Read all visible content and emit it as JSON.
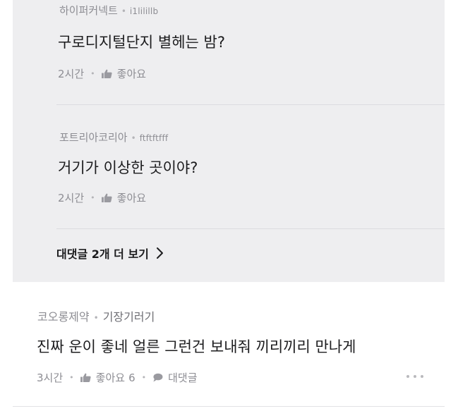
{
  "colors": {
    "reply_background": "#eeeef0",
    "meta_text": "#8d8d93",
    "body_text": "#1c1c1e"
  },
  "replies": [
    {
      "author": "하이퍼커넥트",
      "handle": "i1lilillb",
      "text": "구로디지털단지 별헤는 밤?",
      "time": "2시간",
      "like_label": "좋아요"
    },
    {
      "author": "포트리아코리아",
      "handle": "ftftftfff",
      "text": "거기가 이상한 곳이야?",
      "time": "2시간",
      "like_label": "좋아요"
    }
  ],
  "more_replies": {
    "label": "대댓글 2개 더 보기"
  },
  "comment": {
    "company": "코오롱제약",
    "nickname": "기장기러기",
    "text": "진짜 운이 좋네 얼른 그런건 보내줘 끼리끼리 만나게",
    "time": "3시간",
    "like_label": "좋아요",
    "like_count": "6",
    "reply_label": "대댓글"
  },
  "icons": {
    "like": "thumbs-up-icon",
    "reply": "speech-bubble-icon",
    "more": "more-dots-icon",
    "expand": "chevron-right-icon"
  }
}
